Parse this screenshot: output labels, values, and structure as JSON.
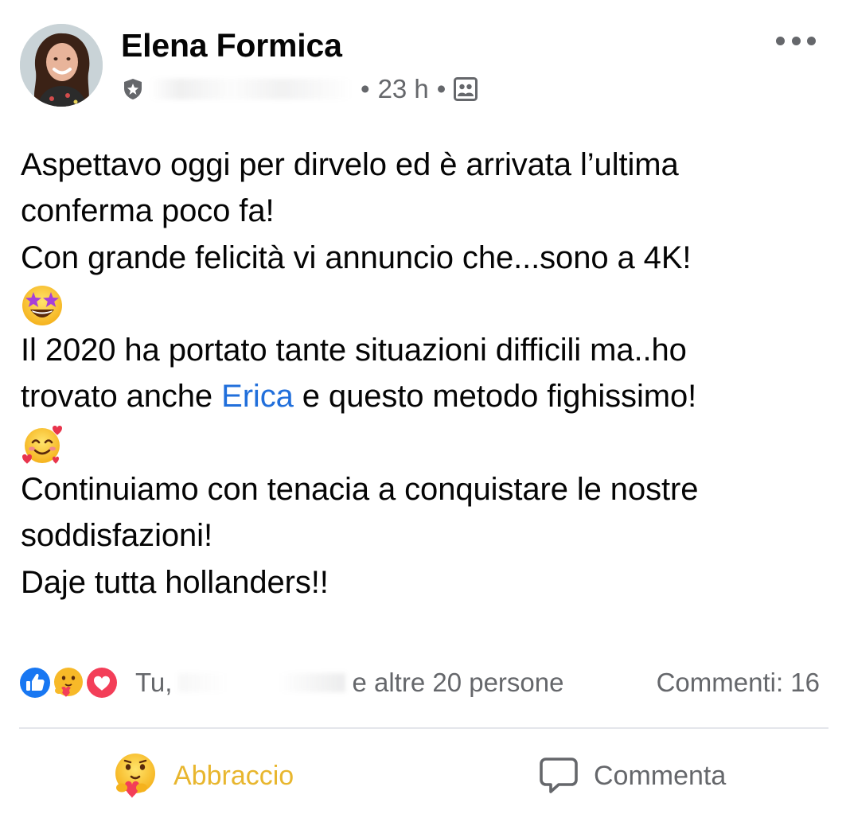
{
  "author": {
    "name": "Elena Formica"
  },
  "meta": {
    "time": "23 h",
    "separator": "•",
    "group_badge_icon": "group-shield-icon",
    "audience_icon": "group-audience-icon"
  },
  "post": {
    "lines": [
      "Aspettavo oggi per dirvelo ed è arrivata l’ultima",
      "conferma poco fa!",
      "Con grande felicità vi annuncio che...sono a 4K!",
      "Il 2020 ha portato tante situazioni difficili ma..ho"
    ],
    "line5_before": "trovato anche ",
    "mention": "Erica",
    "line5_after": " e questo metodo fighissimo!",
    "lines_end": [
      "Continuiamo con tenacia a conquistare le nostre",
      "soddisfazioni!",
      "Daje tutta hollanders!!"
    ],
    "emoji1": "star-struck-emoji",
    "emoji2": "smiling-face-with-hearts-emoji"
  },
  "reactions": {
    "icons": [
      "like-reaction-icon",
      "care-reaction-icon",
      "love-reaction-icon"
    ],
    "prefix": "Tu,",
    "suffix": "e altre 20 persone",
    "comments": "Commenti: 16"
  },
  "actions": {
    "care_label": "Abbraccio",
    "comment_label": "Commenta"
  },
  "colors": {
    "mention": "#216fdb",
    "care_action": "#e8b62e",
    "secondary_text": "#65676b",
    "like_blue": "#1877f2",
    "love_red": "#f33e58"
  }
}
